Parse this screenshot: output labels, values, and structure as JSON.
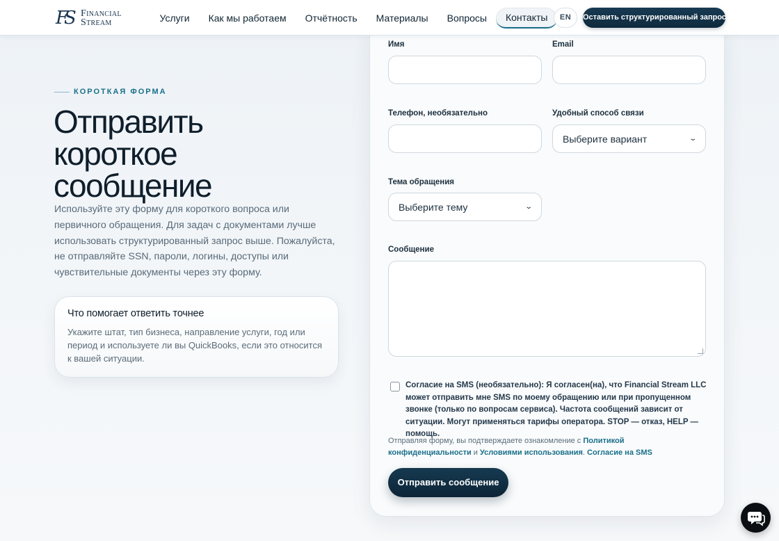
{
  "header": {
    "logo": {
      "line1": "Financial",
      "line2": "Stream"
    },
    "nav": [
      {
        "label": "Услуги"
      },
      {
        "label": "Как мы работаем"
      },
      {
        "label": "Отчётность"
      },
      {
        "label": "Материалы"
      },
      {
        "label": "Вопросы"
      },
      {
        "label": "Контакты",
        "active": true
      }
    ],
    "lang_label": "EN",
    "cta_label": "Оставить структурированный запрос"
  },
  "intro": {
    "eyebrow": "КОРОТКАЯ ФОРМА",
    "title_lines": [
      "Отправить",
      "короткое",
      "сообщение"
    ],
    "lead": "Используйте эту форму для короткого вопроса или первичного обращения. Для задач с документами лучше использовать структурированный запрос выше. Пожалуйста, не отправляйте SSN, пароли, логины, доступы или чувствительные документы через эту форму."
  },
  "tip": {
    "title": "Что помогает ответить точнее",
    "text": "Укажите штат, тип бизнеса, направление услуги, год или период и используете ли вы QuickBooks, если это относится к вашей ситуации."
  },
  "form": {
    "name_label": "Имя",
    "email_label": "Email",
    "phone_label": "Телефон, необязательно",
    "contact_method_label": "Удобный способ связи",
    "contact_method_value": "Выберите вариант",
    "topic_label": "Тема обращения",
    "topic_value": "Выберите тему",
    "message_label": "Сообщение",
    "consent_text": "Согласие на SMS (необязательно): Я согласен(на), что Financial Stream LLC может отправить мне SMS по моему обращению или при пропущенном звонке (только по вопросам сервиса). Частота сообщений зависит от ситуации. Могут применяться тарифы оператора. STOP — отказ, HELP — помощь.",
    "policy_prefix": "Отправляя форму, вы подтверждаете ознакомление с ",
    "policy_link_privacy": "Политикой конфиденциальности",
    "policy_and": " и ",
    "policy_link_terms": "Условиями использования",
    "policy_dot": ". ",
    "policy_link_sms": "Согласие на SMS",
    "submit_label": "Отправить сообщение"
  },
  "colors": {
    "accent": "#1a6f8a",
    "primary_dark": "#0f2a3e"
  },
  "icons": {
    "chat": "chat-bubble-icon"
  }
}
